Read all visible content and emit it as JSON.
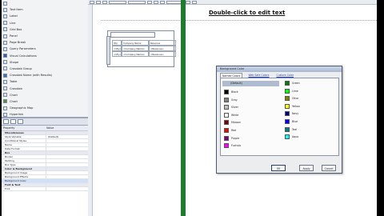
{
  "editor": {
    "edit_text_hint": "Double-click to edit text"
  },
  "toolbox": {
    "items": [
      "",
      "Text Item",
      "Label",
      "Line",
      "Grid Box",
      "Panel",
      "Page Break",
      "Query Parameters",
      "Visual Calculations",
      "Shape",
      "Crosstab Group",
      "Crosstab Name (with Results)",
      "Table",
      "Crosstab",
      "Chart",
      "Chart",
      "Geographic Map",
      "Hyperlink",
      "Button",
      "Tip"
    ]
  },
  "properties": {
    "columns": [
      "Property",
      "Value"
    ],
    "rows": [
      {
        "name": "Miscellaneous",
        "value": "",
        "section": true
      },
      {
        "name": "Style Variable",
        "value": "(Default)"
      },
      {
        "name": "Conditional Styles",
        "value": ""
      },
      {
        "name": "Name",
        "value": ""
      },
      {
        "name": "Data Format",
        "value": ""
      },
      {
        "name": "Box",
        "value": "",
        "section": true
      },
      {
        "name": "Border",
        "value": ""
      },
      {
        "name": "Padding",
        "value": ""
      },
      {
        "name": "Box Type",
        "value": ""
      },
      {
        "name": "Color & Background",
        "value": "",
        "section": true
      },
      {
        "name": "Background Image",
        "value": ""
      },
      {
        "name": "Background Effects",
        "value": ""
      },
      {
        "name": "Background Color",
        "value": "",
        "selected": true
      },
      {
        "name": "Font & Text",
        "value": "",
        "section": true
      },
      {
        "name": "Font",
        "value": ""
      }
    ]
  },
  "table": {
    "search_placeholder": "",
    "rows": [
      [
        "Qty",
        "Company Name",
        "Revenue"
      ],
      [
        "<Qty>",
        "<Company Name>",
        "<Revenue>"
      ],
      [
        "<Qty>",
        "<Company Name>",
        "<Revenue>"
      ]
    ]
  },
  "dialog": {
    "title": "Background Color",
    "tabs": [
      "Named Colors",
      "Web Safe Colors",
      "Custom Color"
    ],
    "default_label": "(Default)",
    "left_colors": [
      {
        "name": "Black",
        "hex": "#000000"
      },
      {
        "name": "Gray",
        "hex": "#808080"
      },
      {
        "name": "Silver",
        "hex": "#c0c0c0"
      },
      {
        "name": "White",
        "hex": "#ffffff"
      },
      {
        "name": "Maroon",
        "hex": "#800000"
      },
      {
        "name": "Red",
        "hex": "#ff0000"
      },
      {
        "name": "Purple",
        "hex": "#800080"
      },
      {
        "name": "Fuchsia",
        "hex": "#ff00ff"
      }
    ],
    "right_colors": [
      {
        "name": "Green",
        "hex": "#008000"
      },
      {
        "name": "Lime",
        "hex": "#00ff00"
      },
      {
        "name": "Olive",
        "hex": "#808000"
      },
      {
        "name": "Yellow",
        "hex": "#ffff00"
      },
      {
        "name": "Navy",
        "hex": "#000080"
      },
      {
        "name": "Blue",
        "hex": "#0000ff"
      },
      {
        "name": "Teal",
        "hex": "#008080"
      },
      {
        "name": "Aqua",
        "hex": "#00ffff"
      }
    ],
    "buttons": {
      "ok": "OK",
      "apply": "Apply",
      "cancel": "Cancel"
    }
  },
  "colors": {
    "accent_green": "#1e7a2d",
    "selection": "#aebbd0"
  }
}
